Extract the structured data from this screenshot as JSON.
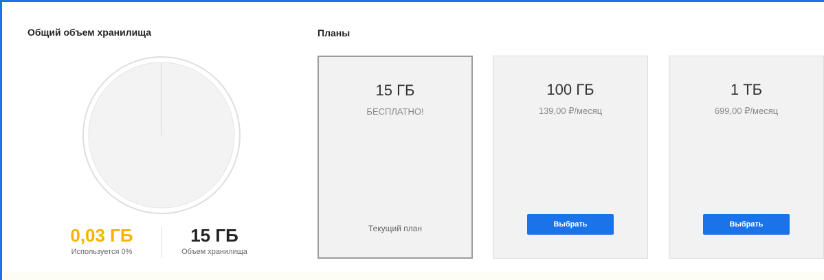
{
  "storage": {
    "title": "Общий объем хранилища",
    "used_fraction": 0.0,
    "used": {
      "value": "0,03 ГБ",
      "caption": "Используется 0%"
    },
    "total": {
      "value": "15 ГБ",
      "caption": "Объем хранилища"
    }
  },
  "plans": {
    "title": "Планы",
    "items": [
      {
        "size": "15 ГБ",
        "price": "БЕСПЛАТНО!",
        "current_label": "Текущий план",
        "is_current": true
      },
      {
        "size": "100 ГБ",
        "price": "139,00 ₽/месяц",
        "button_label": "Выбрать",
        "is_current": false
      },
      {
        "size": "1 ТБ",
        "price": "699,00 ₽/месяц",
        "button_label": "Выбрать",
        "is_current": false
      }
    ]
  },
  "colors": {
    "accent": "#1a73e8",
    "used": "#f4b400",
    "card_background": "#f2f2f2"
  }
}
